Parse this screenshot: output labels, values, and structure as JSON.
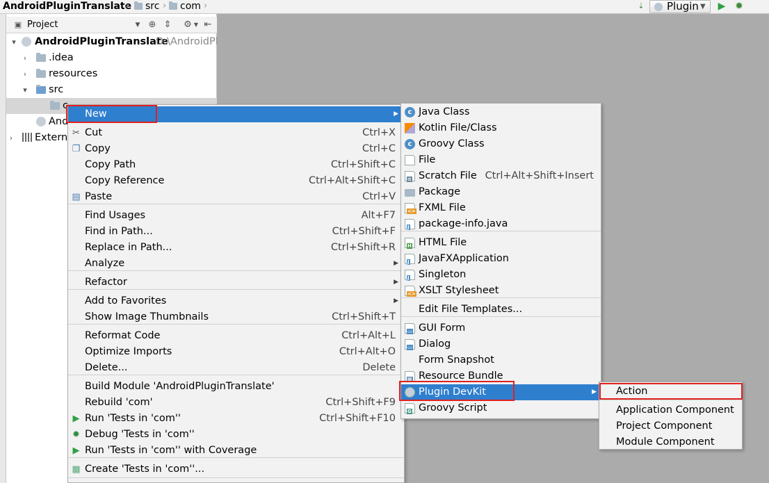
{
  "breadcrumbs": [
    {
      "label": "AndroidPluginTranslate",
      "icon": "module-icon"
    },
    {
      "label": "src",
      "icon": "folder-icon"
    },
    {
      "label": "com",
      "icon": "folder-icon"
    }
  ],
  "toolbar": {
    "run_config": "Plugin",
    "icons": [
      "sort-icon",
      "run-icon",
      "debug-icon"
    ]
  },
  "project_panel": {
    "title": "Project",
    "tree": [
      {
        "label": "AndroidPluginTranslate",
        "path": "D:\\AndroidPl",
        "icon": "module-icon",
        "expanded": true
      },
      {
        "label": ".idea",
        "icon": "folder-icon",
        "expanded": false
      },
      {
        "label": "resources",
        "icon": "folder-icon",
        "expanded": false
      },
      {
        "label": "src",
        "icon": "folder-icon",
        "expanded": true
      },
      {
        "label": "c",
        "icon": "package-icon",
        "selected": true
      },
      {
        "label": "And",
        "icon": "module-icon"
      },
      {
        "label": "Externa",
        "icon": "libraries-icon",
        "expanded": false
      }
    ]
  },
  "context_menu": {
    "items": [
      {
        "label": "New",
        "shortcut": "",
        "submenu": true,
        "highlighted": true
      },
      {
        "label": "Cut",
        "shortcut": "Ctrl+X",
        "icon": "scissors-icon"
      },
      {
        "label": "Copy",
        "shortcut": "Ctrl+C",
        "icon": "copy-icon"
      },
      {
        "label": "Copy Path",
        "shortcut": "Ctrl+Shift+C"
      },
      {
        "label": "Copy Reference",
        "shortcut": "Ctrl+Alt+Shift+C"
      },
      {
        "label": "Paste",
        "shortcut": "Ctrl+V",
        "icon": "paste-icon"
      },
      {
        "label": "Find Usages",
        "shortcut": "Alt+F7"
      },
      {
        "label": "Find in Path...",
        "shortcut": "Ctrl+Shift+F"
      },
      {
        "label": "Replace in Path...",
        "shortcut": "Ctrl+Shift+R"
      },
      {
        "label": "Analyze",
        "shortcut": "",
        "submenu": true
      },
      {
        "label": "Refactor",
        "shortcut": "",
        "submenu": true
      },
      {
        "label": "Add to Favorites",
        "shortcut": "",
        "submenu": true
      },
      {
        "label": "Show Image Thumbnails",
        "shortcut": "Ctrl+Shift+T"
      },
      {
        "label": "Reformat Code",
        "shortcut": "Ctrl+Alt+L"
      },
      {
        "label": "Optimize Imports",
        "shortcut": "Ctrl+Alt+O"
      },
      {
        "label": "Delete...",
        "shortcut": "Delete"
      },
      {
        "label": "Build Module 'AndroidPluginTranslate'",
        "shortcut": ""
      },
      {
        "label": "Rebuild 'com'",
        "shortcut": "Ctrl+Shift+F9"
      },
      {
        "label": "Run 'Tests in 'com''",
        "shortcut": "Ctrl+Shift+F10",
        "icon": "run-icon"
      },
      {
        "label": "Debug 'Tests in 'com''",
        "shortcut": "",
        "icon": "debug-icon"
      },
      {
        "label": "Run 'Tests in 'com'' with Coverage",
        "shortcut": "",
        "icon": "coverage-icon"
      },
      {
        "label": "Create 'Tests in 'com''...",
        "shortcut": "",
        "icon": "create-test-icon"
      }
    ]
  },
  "new_submenu": {
    "items": [
      {
        "label": "Java Class",
        "shortcut": "",
        "icon": "java-class-icon"
      },
      {
        "label": "Kotlin File/Class",
        "shortcut": "",
        "icon": "kotlin-icon"
      },
      {
        "label": "Groovy Class",
        "shortcut": "",
        "icon": "groovy-class-icon"
      },
      {
        "label": "File",
        "shortcut": "",
        "icon": "file-icon"
      },
      {
        "label": "Scratch File",
        "shortcut": "Ctrl+Alt+Shift+Insert",
        "icon": "scratch-file-icon"
      },
      {
        "label": "Package",
        "shortcut": "",
        "icon": "package-icon"
      },
      {
        "label": "FXML File",
        "shortcut": "",
        "icon": "fxml-file-icon"
      },
      {
        "label": "package-info.java",
        "shortcut": "",
        "icon": "java-file-icon"
      },
      {
        "label": "HTML File",
        "shortcut": "",
        "icon": "html-file-icon"
      },
      {
        "label": "JavaFXApplication",
        "shortcut": "",
        "icon": "java-file-icon"
      },
      {
        "label": "Singleton",
        "shortcut": "",
        "icon": "java-file-icon"
      },
      {
        "label": "XSLT Stylesheet",
        "shortcut": "",
        "icon": "xslt-file-icon"
      },
      {
        "label": "Edit File Templates...",
        "shortcut": ""
      },
      {
        "label": "GUI Form",
        "shortcut": "",
        "icon": "gui-form-icon"
      },
      {
        "label": "Dialog",
        "shortcut": "",
        "icon": "dialog-icon"
      },
      {
        "label": "Form Snapshot",
        "shortcut": ""
      },
      {
        "label": "Resource Bundle",
        "shortcut": "",
        "icon": "resource-bundle-icon"
      },
      {
        "label": "Plugin DevKit",
        "shortcut": "",
        "submenu": true,
        "highlighted": true,
        "icon": "plugin-icon"
      },
      {
        "label": "Groovy Script",
        "shortcut": "",
        "icon": "groovy-script-icon"
      }
    ]
  },
  "devkit_submenu": {
    "items": [
      {
        "label": "Action",
        "highlighted": true
      },
      {
        "label": "Application Component"
      },
      {
        "label": "Project Component"
      },
      {
        "label": "Module Component"
      }
    ]
  },
  "colors": {
    "highlight": "#2f7fcf",
    "annotation": "#e02020",
    "menu_bg": "#f2f2f2",
    "background": "#ababab"
  }
}
